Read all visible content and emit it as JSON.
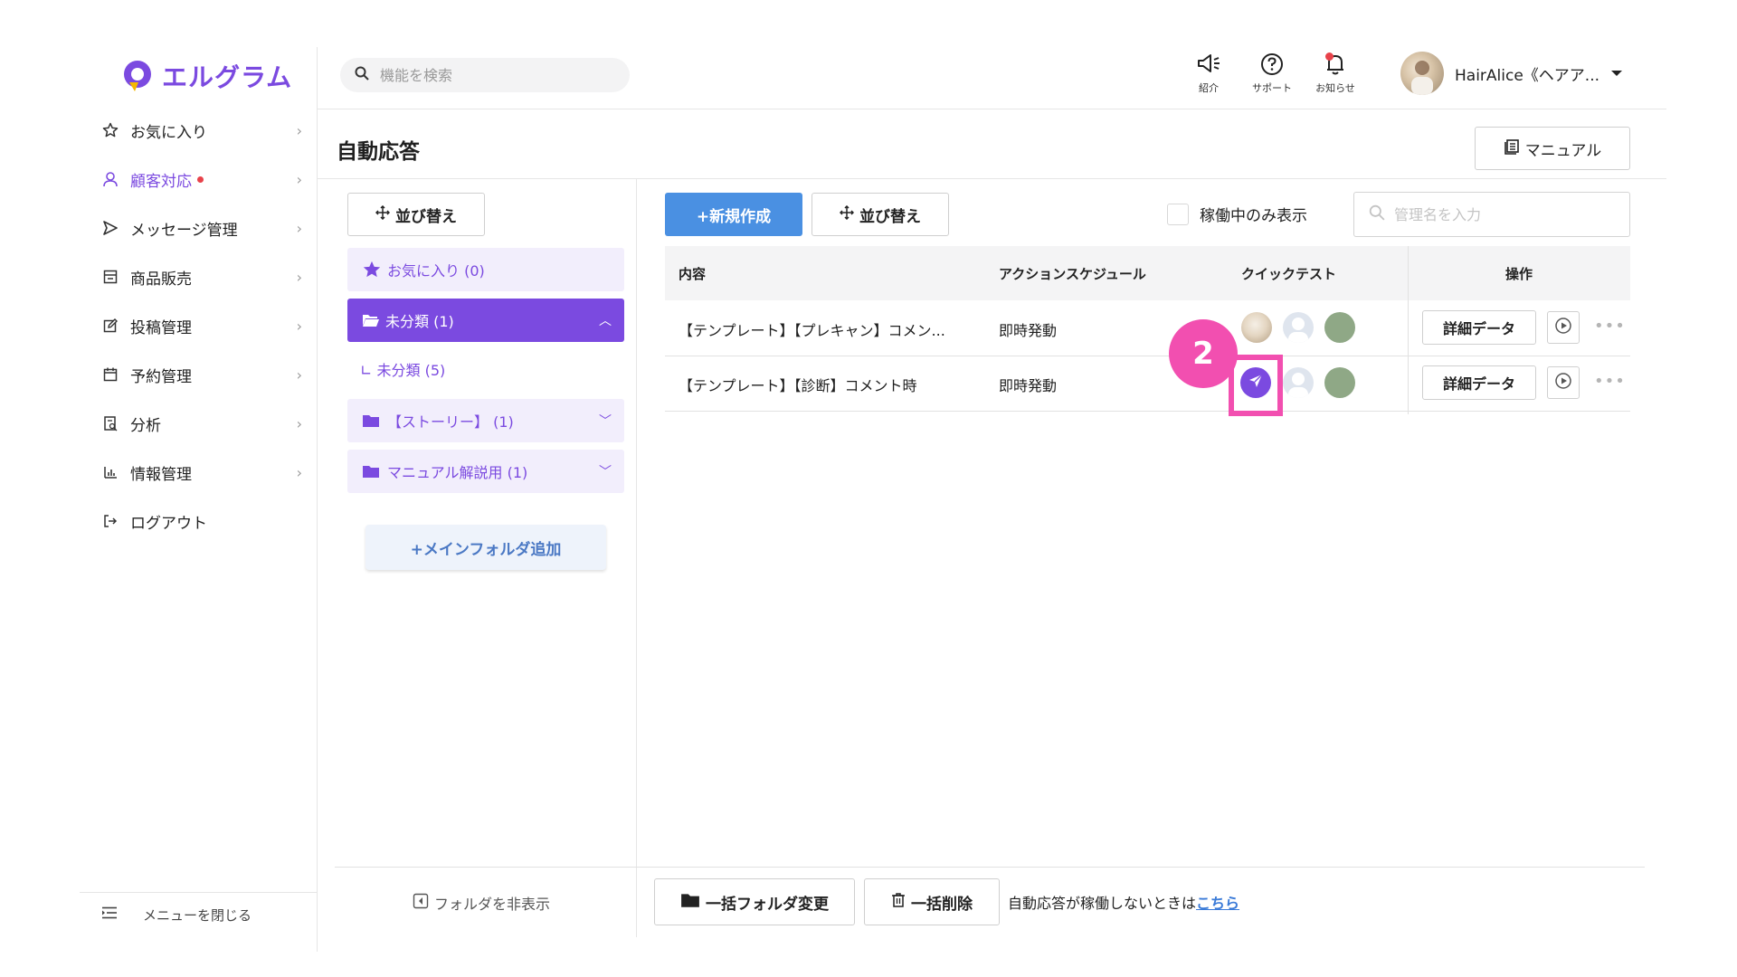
{
  "brand": {
    "name": "エルグラム",
    "color": "#7b4ae0"
  },
  "search": {
    "placeholder": "機能を検索"
  },
  "header": {
    "tools": [
      {
        "label": "紹介",
        "icon": "megaphone-icon"
      },
      {
        "label": "サポート",
        "icon": "help-circle-icon"
      },
      {
        "label": "お知らせ",
        "icon": "bell-icon"
      }
    ],
    "user_name": "HairAlice《ヘアア..."
  },
  "sidebar": {
    "items": [
      {
        "label": "お気に入り",
        "icon": "star-icon"
      },
      {
        "label": "顧客対応",
        "icon": "user-icon",
        "active": true
      },
      {
        "label": "メッセージ管理",
        "icon": "send-icon"
      },
      {
        "label": "商品販売",
        "icon": "store-icon"
      },
      {
        "label": "投稿管理",
        "icon": "edit-icon"
      },
      {
        "label": "予約管理",
        "icon": "calendar-icon"
      },
      {
        "label": "分析",
        "icon": "report-icon"
      },
      {
        "label": "情報管理",
        "icon": "bar-chart-icon"
      },
      {
        "label": "ログアウト",
        "icon": "logout-icon"
      }
    ],
    "close_menu": "メニューを閉じる"
  },
  "page": {
    "title": "自動応答",
    "manual_button": "マニュアル"
  },
  "folders": {
    "sort_button": "並び替え",
    "favorites": "お気に入り (0)",
    "selected": "未分類 (1)",
    "sub": "∟ 未分類 (5)",
    "story": "【ストーリー】 (1)",
    "manual": "マニュアル解説用 (1)",
    "add_main": "+メインフォルダ追加",
    "hide": "フォルダを非表示"
  },
  "toolbar": {
    "new_button": "+新規作成",
    "sort_button": "並び替え",
    "active_only": "稼働中のみ表示",
    "name_placeholder": "管理名を入力"
  },
  "table": {
    "headers": [
      "内容",
      "アクションスケジュール",
      "クイックテスト",
      "操作"
    ],
    "rows": [
      {
        "content": "【テンプレート】【プレキャン】コメン...",
        "schedule": "即時発動",
        "detail": "詳細データ"
      },
      {
        "content": "【テンプレート】【診断】コメント時",
        "schedule": "即時発動",
        "detail": "詳細データ"
      }
    ]
  },
  "annotation": {
    "step": "2",
    "color": "#f24fb0"
  },
  "bottom": {
    "bulk_folder": "一括フォルダ変更",
    "bulk_delete": "一括削除",
    "note": "自動応答が稼働しないときは",
    "note_link": "こちら"
  }
}
